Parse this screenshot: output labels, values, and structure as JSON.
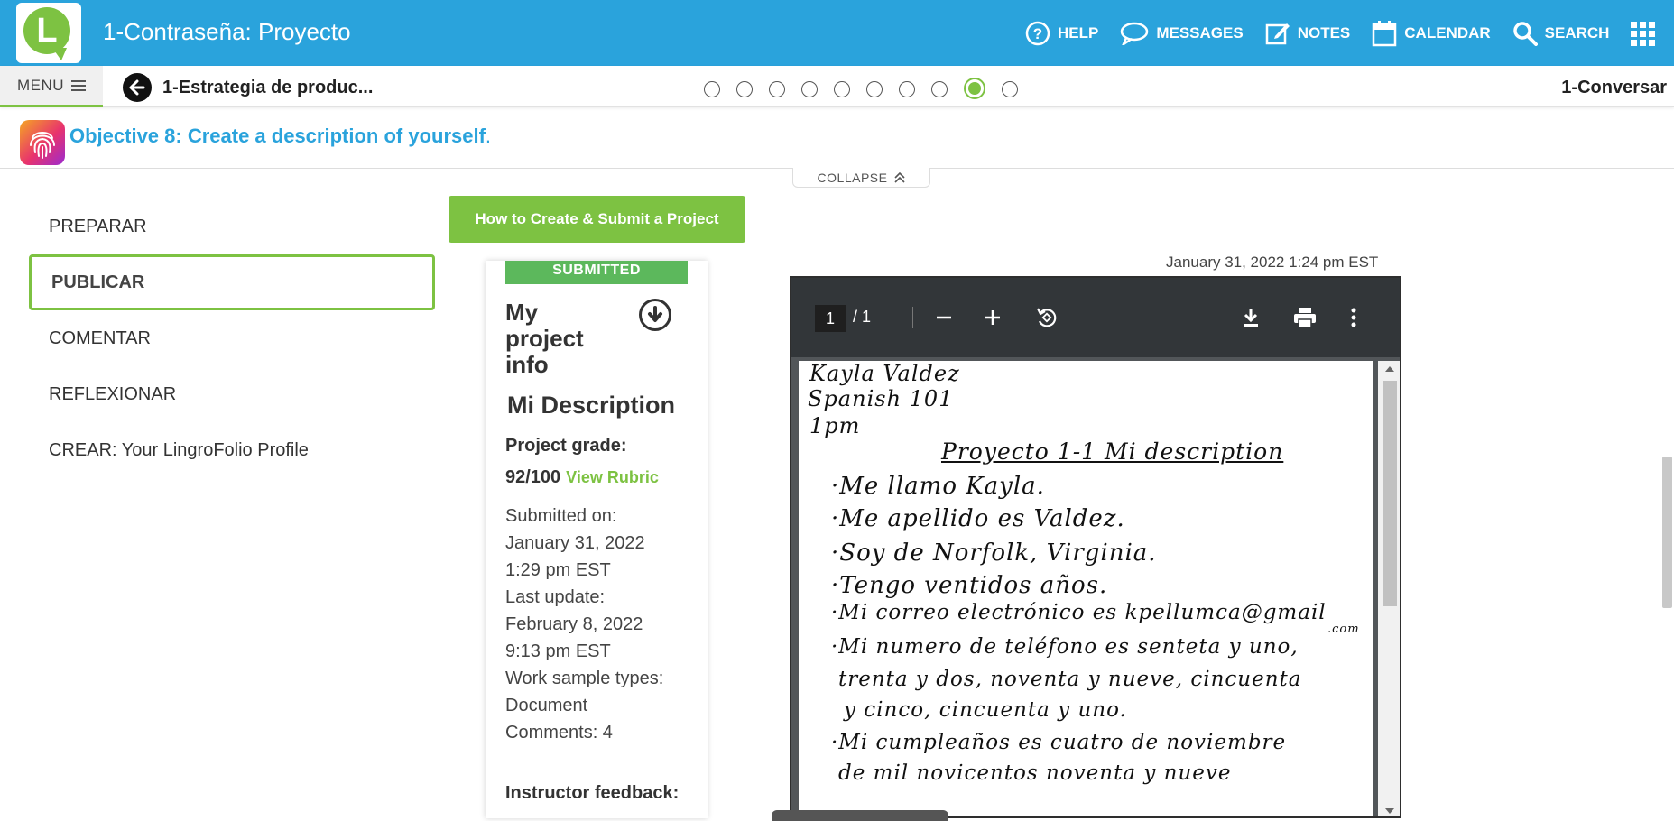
{
  "header": {
    "title": "1-Contraseña: Proyecto",
    "nav": [
      {
        "label": "HELP",
        "icon": "help-icon"
      },
      {
        "label": "MESSAGES",
        "icon": "chat-bubble-icon"
      },
      {
        "label": "NOTES",
        "icon": "edit-icon"
      },
      {
        "label": "CALENDAR",
        "icon": "calendar-icon"
      },
      {
        "label": "SEARCH",
        "icon": "search-icon"
      },
      {
        "label": "",
        "icon": "apps-grid-icon"
      }
    ],
    "brand_color": "#2aa3dc",
    "accent_color": "#7dc242"
  },
  "subbar": {
    "menu_label": "MENU",
    "prev_crumb": "1-Estrategia de produc...",
    "next_crumb": "1-Conversar",
    "progress": {
      "total": 10,
      "active_index": 8
    }
  },
  "objective": {
    "title": "Objective 8: Create a description of yourself",
    "suffix": ".",
    "collapse_label": "COLLAPSE"
  },
  "leftnav": {
    "items": [
      {
        "label": "PREPARAR",
        "active": false
      },
      {
        "label": "PUBLICAR",
        "active": true
      },
      {
        "label": "COMENTAR",
        "active": false
      },
      {
        "label": "REFLEXIONAR",
        "active": false
      },
      {
        "label": "CREAR: Your LingroFolio Profile",
        "active": false
      }
    ]
  },
  "how_button": "How to Create & Submit a Project",
  "project": {
    "status": "SUBMITTED",
    "info_title": "My project info",
    "name": "Mi Description",
    "grade_label": "Project grade:",
    "grade": "92/100",
    "rubric_link": "View Rubric",
    "meta": [
      "Submitted on:",
      "January 31, 2022",
      "1:29 pm EST",
      "Last update:",
      "February 8, 2022",
      "9:13 pm EST",
      "Work sample types:",
      "Document",
      "Comments: 4"
    ],
    "feedback_label": "Instructor feedback:"
  },
  "doc_date": "January 31, 2022 1:24 pm EST",
  "pdf": {
    "page_current": "1",
    "page_total": "/  1",
    "lines": [
      "Kayla Valdez",
      "Spanish 101",
      "1pm",
      "Proyecto 1-1 Mi description",
      "·Me  llamo  Kayla.",
      "·Me  apellido  es  Valdez.",
      "·Soy  de  Norfolk, Virginia.",
      "·Tengo  ventidos  años.",
      "·Mi  correo  electrónico  es  kpellumca@gmail",
      ".com",
      "·Mi  numero  de  teléfono  es  senteta  y  uno,",
      "trenta  y  dos,  noventa  y  nueve,  cincuenta",
      "y  cinco,  cincuenta  y  uno.",
      "·Mi  cumpleaños  es  cuatro  de  noviembre",
      "de  mil  novicentos  noventa  y  nueve"
    ]
  }
}
